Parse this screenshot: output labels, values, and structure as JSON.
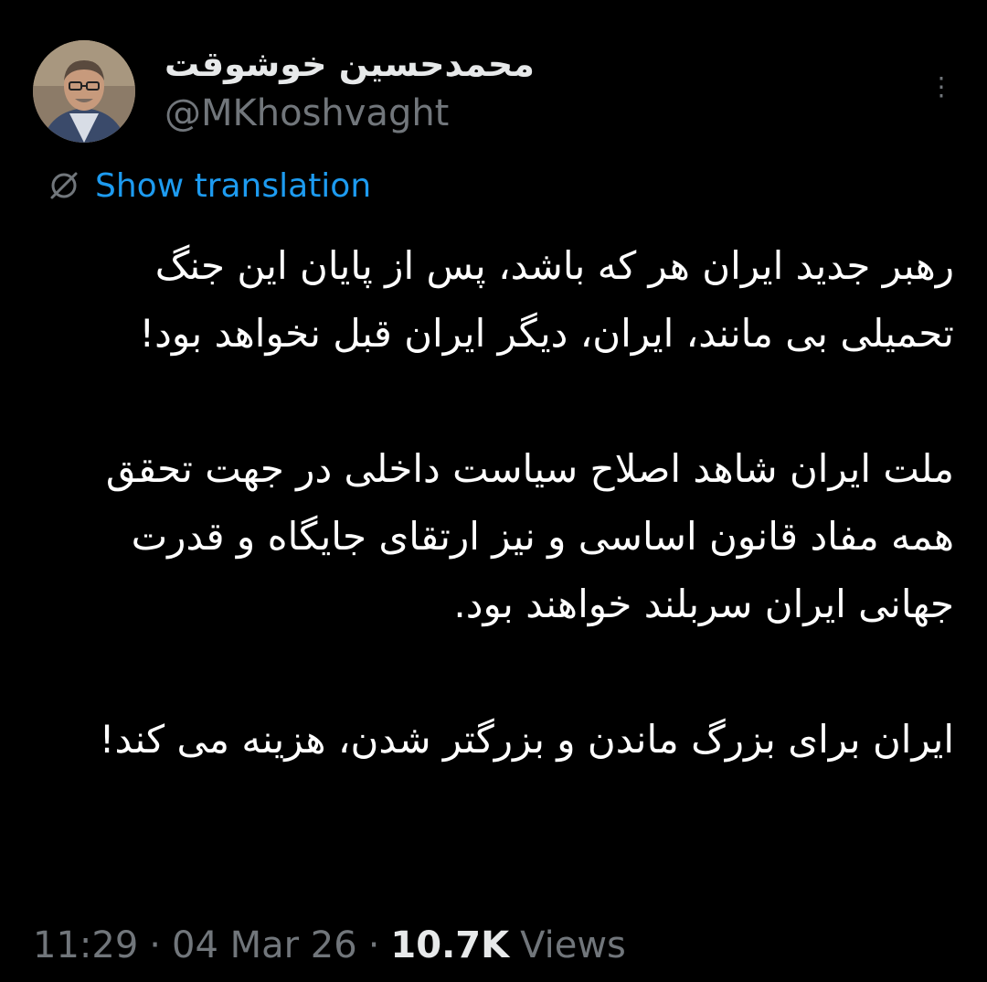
{
  "author": {
    "name": "محمدحسین خوشوقت",
    "handle": "@MKhoshvaght"
  },
  "menu_glyph": "⋮",
  "translation": {
    "label": "Show translation"
  },
  "body": {
    "paragraphs": [
      "رهبر جدید ایران هر که باشد، پس از پایان این جنگ تحمیلی بی مانند، ایران، دیگر ایران قبل نخواهد بود!",
      "ملت ایران شاهد اصلاح سیاست داخلی در جهت تحقق همه مفاد قانون اساسی و نیز ارتقای جایگاه و قدرت جهانی ایران سربلند خواهند بود.",
      "ایران برای بزرگ ماندن و بزرگتر شدن، هزینه می کند!"
    ]
  },
  "meta": {
    "time": "11:29",
    "separator": "·",
    "date": "04 Mar 26",
    "views_count": "10.7K",
    "views_label": "Views"
  },
  "colors": {
    "background": "#000000",
    "primary_text": "#e7e9ea",
    "secondary_text": "#71767b",
    "link": "#1d9bf0"
  },
  "icons": {
    "avatar": "profile-photo",
    "translate": "globe-slash-icon",
    "more": "more-menu-icon"
  }
}
